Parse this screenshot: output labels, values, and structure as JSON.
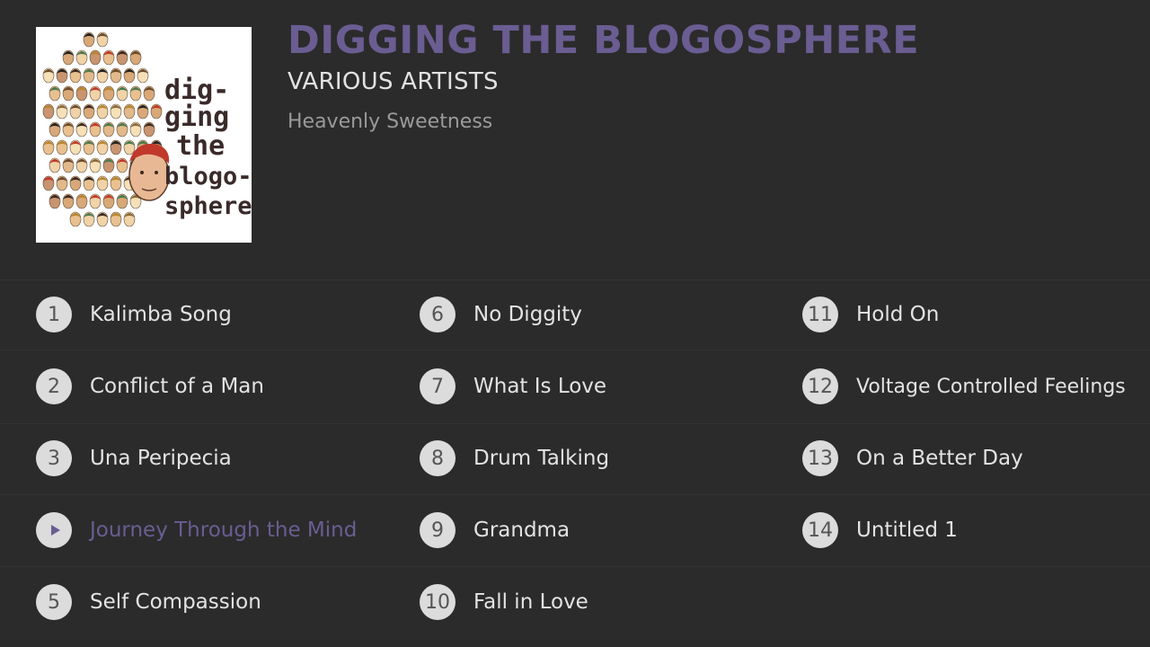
{
  "album": {
    "title": "DIGGING THE BLOGOSPHERE",
    "artist": "VARIOUS ARTISTS",
    "label": "Heavenly Sweetness",
    "cover_text": [
      "dig-",
      "ging",
      "the",
      "blogo-",
      "sphere"
    ]
  },
  "colors": {
    "accent": "#6a5d92",
    "background": "#2b2b2b",
    "badge": "#dcdcdc"
  },
  "now_playing_track": 4,
  "tracks": [
    {
      "number": "1",
      "title": "Kalimba Song"
    },
    {
      "number": "2",
      "title": "Conflict of a Man"
    },
    {
      "number": "3",
      "title": "Una Peripecia"
    },
    {
      "number": "4",
      "title": "Journey Through the Mind",
      "playing": true,
      "icon": "play-icon"
    },
    {
      "number": "5",
      "title": "Self Compassion"
    },
    {
      "number": "6",
      "title": "No Diggity"
    },
    {
      "number": "7",
      "title": "What Is Love"
    },
    {
      "number": "8",
      "title": "Drum Talking"
    },
    {
      "number": "9",
      "title": "Grandma"
    },
    {
      "number": "10",
      "title": "Fall in Love"
    },
    {
      "number": "11",
      "title": "Hold On"
    },
    {
      "number": "12",
      "title": "Voltage Controlled Feelings"
    },
    {
      "number": "13",
      "title": "On a Better Day"
    },
    {
      "number": "14",
      "title": "Untitled 1"
    }
  ]
}
